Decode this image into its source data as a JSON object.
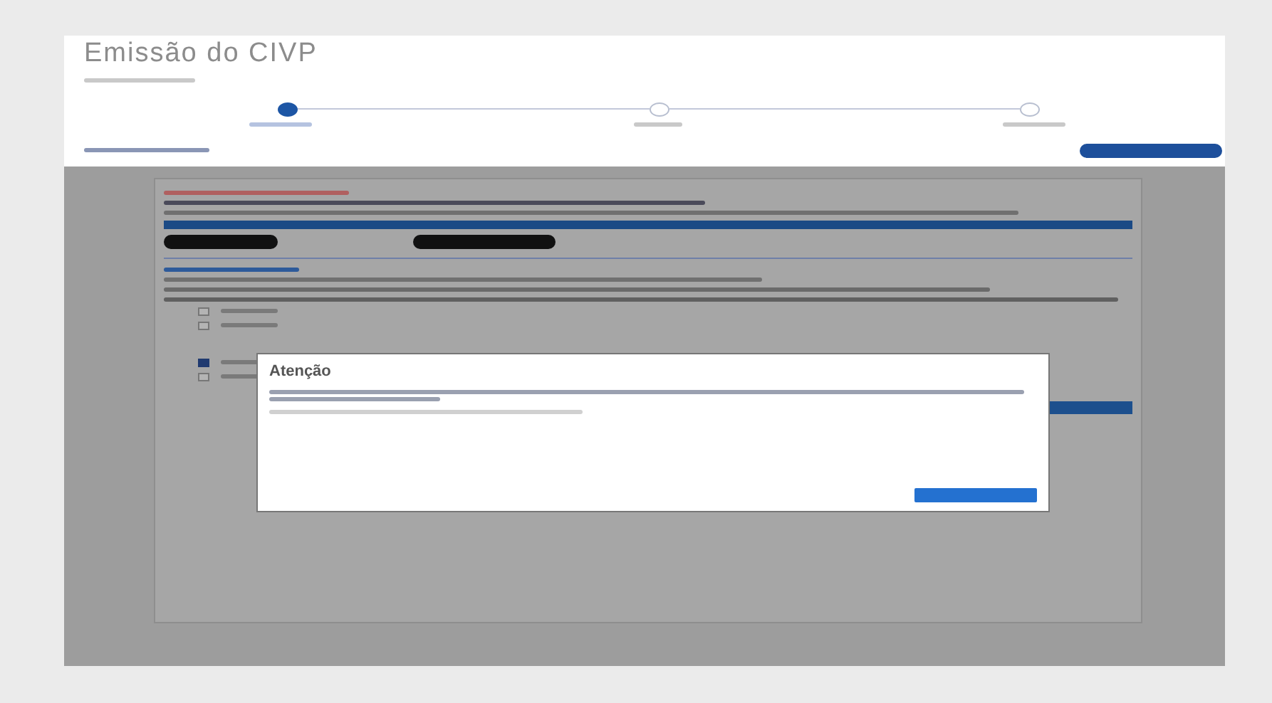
{
  "page": {
    "title": "Emissão do CIVP"
  },
  "stepper": {
    "steps": [
      {
        "selected": true
      },
      {
        "selected": false
      },
      {
        "selected": false
      }
    ]
  },
  "form": {
    "checkboxes": [
      {
        "checked": false
      },
      {
        "checked": false
      },
      {
        "checked": true
      },
      {
        "checked": false
      }
    ]
  },
  "modal": {
    "title": "Atenção"
  }
}
